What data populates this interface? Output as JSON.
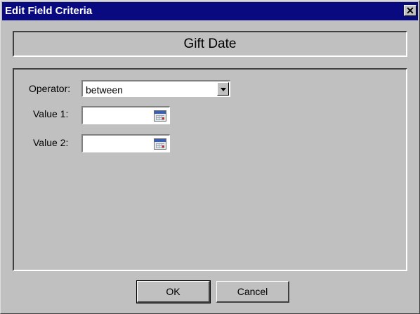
{
  "window": {
    "title": "Edit Field Criteria",
    "close_glyph": "✕"
  },
  "header": {
    "field_name": "Gift Date"
  },
  "form": {
    "operator": {
      "label": "Operator:",
      "value": "between"
    },
    "value1": {
      "label": "Value 1:",
      "value": ""
    },
    "value2": {
      "label": "Value 2:",
      "value": ""
    }
  },
  "buttons": {
    "ok": "OK",
    "cancel": "Cancel"
  },
  "icons": {
    "calendar": "calendar-icon",
    "dropdown": "chevron-down-icon",
    "close": "close-icon"
  },
  "colors": {
    "titlebar": "#0a0a80",
    "face": "#c0c0c0"
  }
}
